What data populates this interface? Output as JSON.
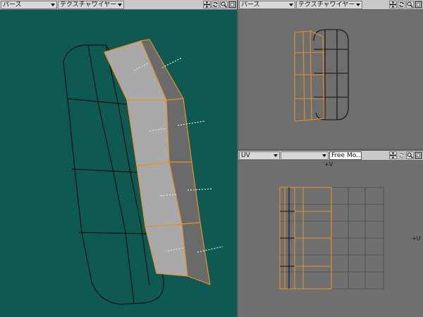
{
  "viewports": {
    "main": {
      "projection": "パース",
      "shading": "テクスチャワイヤー",
      "background": "#0e5a52"
    },
    "top_right": {
      "projection": "パース",
      "shading": "テクスチャワイヤー",
      "background": "#6e6e6e"
    },
    "uv": {
      "projection": "UV",
      "map_name": "Free Mo...",
      "axis_v": "+V",
      "axis_u": "+U",
      "background": "#707070"
    }
  },
  "colors": {
    "wire": "#111111",
    "selected_edge": "#e89020",
    "surface": "#a9a9a9",
    "side_surface": "#6a6a6a",
    "normal": "#e6e6e6"
  },
  "icons": [
    "move-view-icon",
    "rotate-view-icon",
    "zoom-icon",
    "maximize-viewport-icon"
  ]
}
